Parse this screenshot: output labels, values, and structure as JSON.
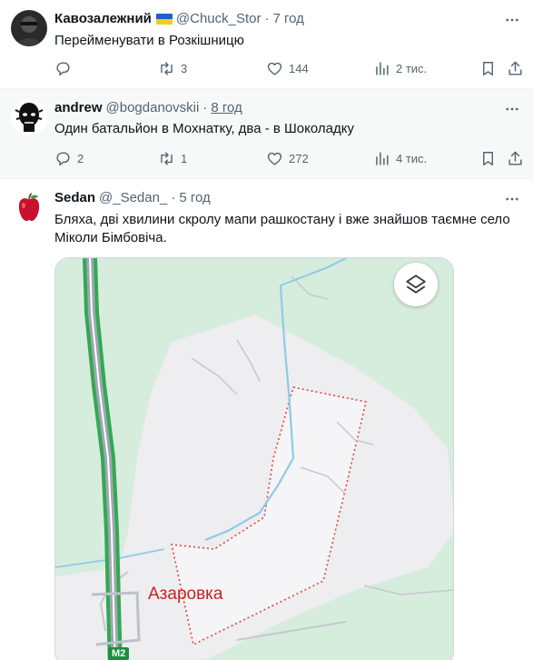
{
  "tweets": [
    {
      "name": "Кавозалежний",
      "has_flag": true,
      "handle": "@Chuck_Stor",
      "time": "7 год",
      "text": "Перейменувати в Розкішницю",
      "replies": "",
      "retweets": "3",
      "likes": "144",
      "views": "2 тис."
    },
    {
      "name": "andrew",
      "handle": "@bogdanovskii",
      "time": "8 год",
      "text": "Один батальйон в Мохнатку, два - в Шоколадку",
      "replies": "2",
      "retweets": "1",
      "likes": "272",
      "views": "4 тис."
    },
    {
      "name": "Sedan",
      "handle": "@_Sedan_",
      "time": "5 год",
      "text": "Бляха, дві хвилини скролу мапи рашкостану і вже знайшов таємне село Міколи Бімбовіча."
    }
  ],
  "map": {
    "place_label": "Азаровка",
    "road_label": "M2",
    "colors": {
      "forest": "#d4ecdc",
      "urban": "#f1f0f2",
      "highway": "#34a853",
      "water": "#8ecbe6",
      "boundary": "#e0463a"
    }
  },
  "icons": {
    "reply": "reply-icon",
    "retweet": "retweet-icon",
    "like": "heart-icon",
    "views": "views-icon",
    "bookmark": "bookmark-icon",
    "share": "share-icon",
    "more": "more-icon",
    "layers": "layers-icon"
  }
}
